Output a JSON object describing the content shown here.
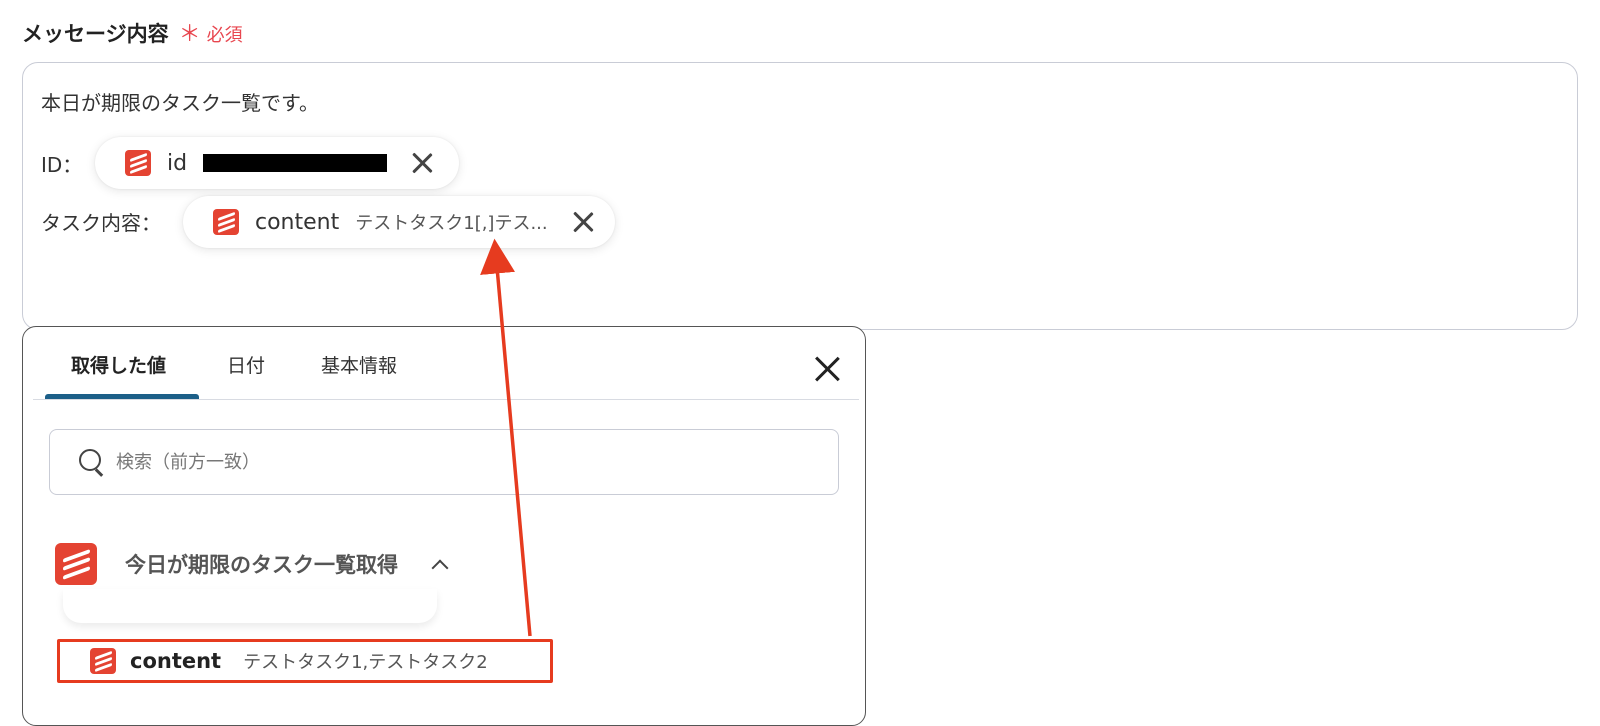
{
  "field": {
    "label": "メッセージ内容",
    "required_star": "＊",
    "required_text": "必須"
  },
  "message": {
    "line1": "本日が期限のタスク一覧です。",
    "id_label": "ID：",
    "task_label": "タスク内容：",
    "chips": [
      {
        "name": "id",
        "value": "(redacted)",
        "icon": "todoist-icon"
      },
      {
        "name": "content",
        "value": "テストタスク1[,]テス...",
        "icon": "todoist-icon"
      }
    ]
  },
  "panel": {
    "tabs": [
      {
        "label": "取得した値",
        "active": true
      },
      {
        "label": "日付",
        "active": false
      },
      {
        "label": "基本情報",
        "active": false
      }
    ],
    "search_placeholder": "検索（前方一致）",
    "group_title": "今日が期限のタスク一覧取得",
    "item": {
      "name": "content",
      "value": "テストタスク1,テストタスク2"
    }
  },
  "colors": {
    "accent_tab": "#1c5f88",
    "todoist": "#e44332",
    "highlight": "#e63b1f",
    "required": "#e8464f"
  }
}
